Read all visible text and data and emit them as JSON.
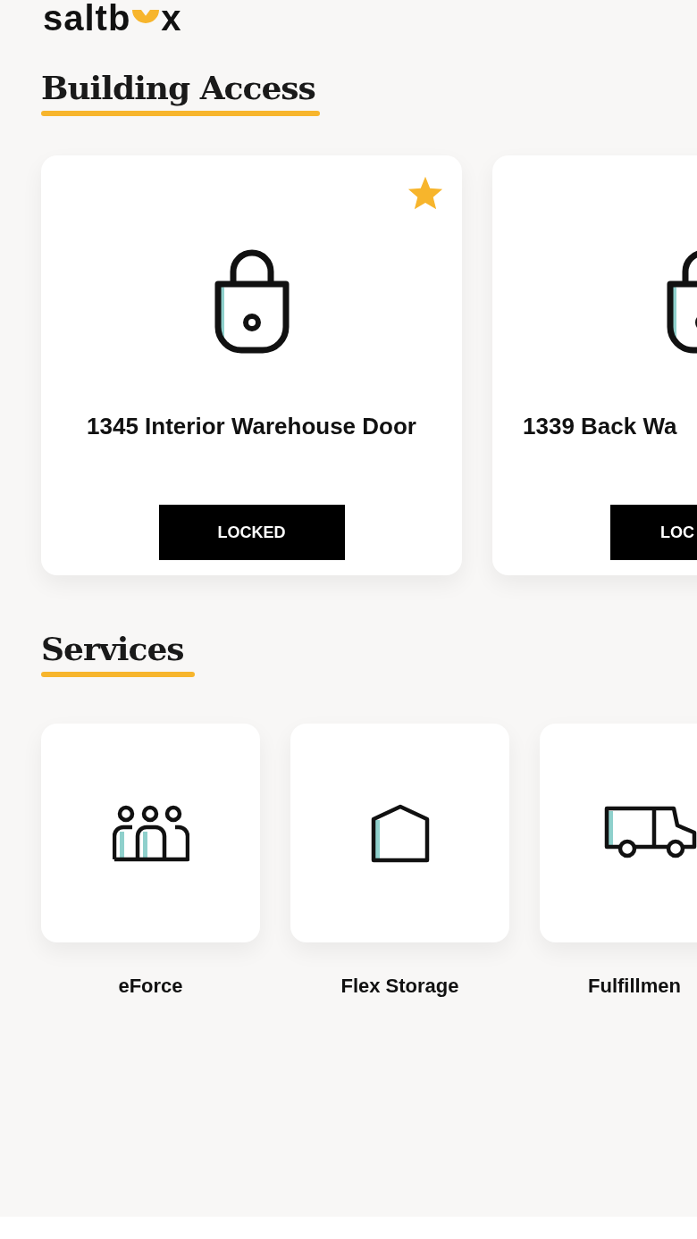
{
  "logo": {
    "before": "saltb",
    "after": "x"
  },
  "building_access": {
    "title": "Building Access",
    "doors": [
      {
        "name": "1345 Interior Warehouse Door",
        "status": "LOCKED",
        "favorite": true
      },
      {
        "name": "1339 Back Wa",
        "status": "LOC"
      }
    ]
  },
  "services": {
    "title": "Services",
    "items": [
      {
        "label": "eForce",
        "kind": "people"
      },
      {
        "label": "Flex Storage",
        "kind": "storage"
      },
      {
        "label": "Fulfillmen",
        "kind": "truck"
      }
    ]
  }
}
